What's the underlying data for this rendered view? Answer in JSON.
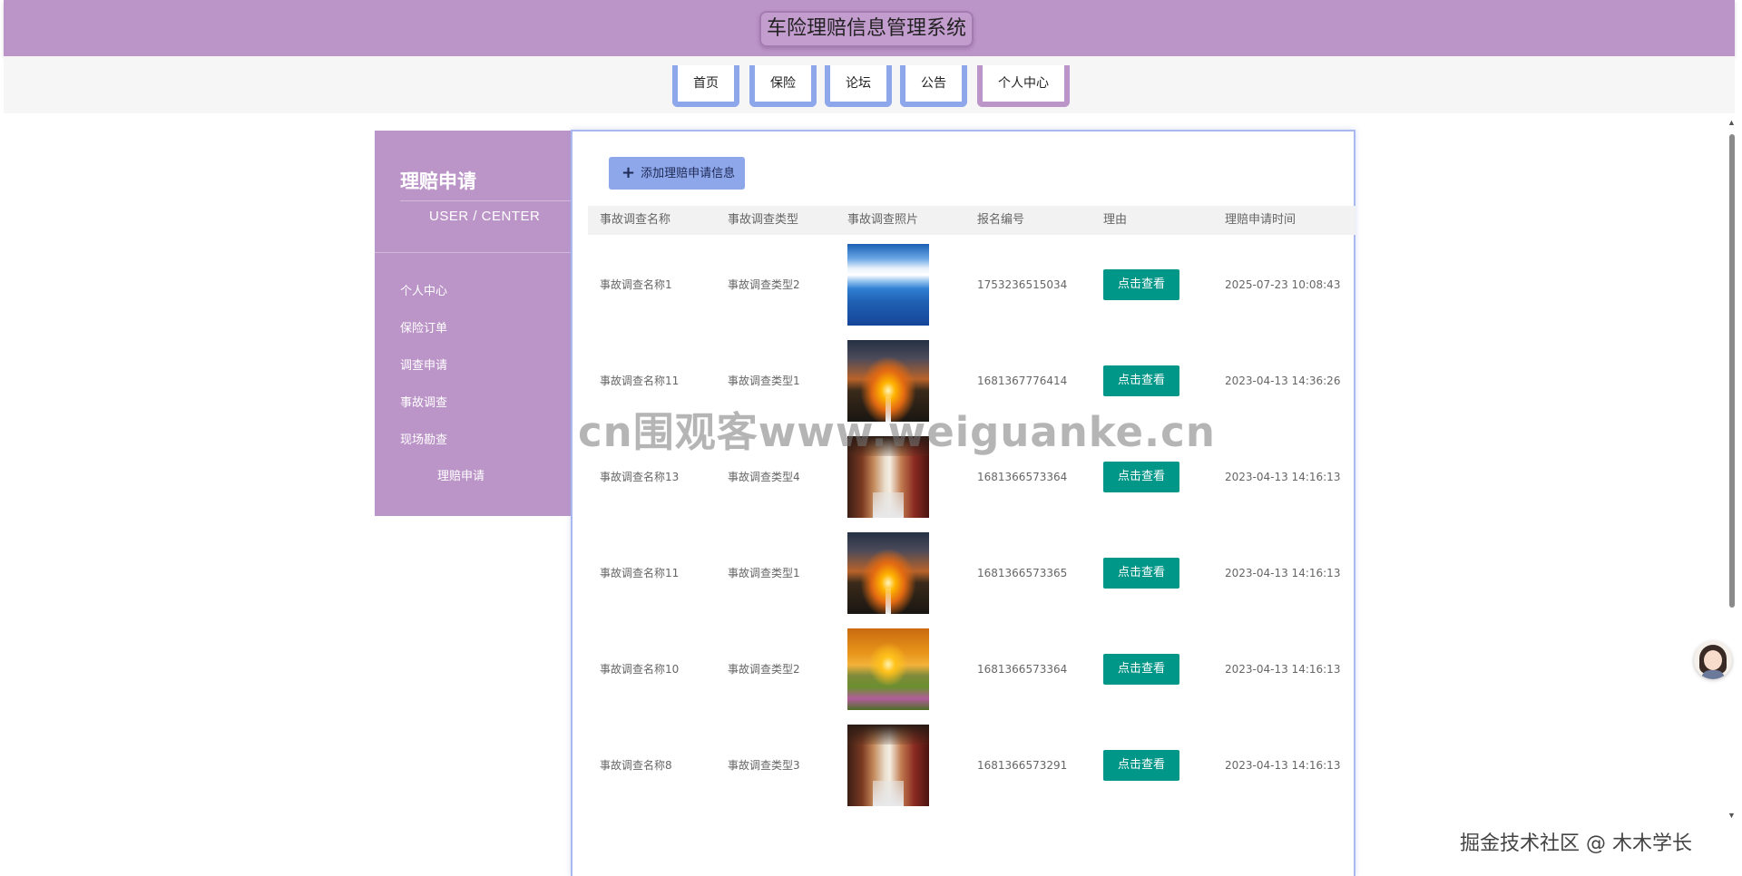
{
  "header": {
    "title": "车险理赔信息管理系统"
  },
  "nav": {
    "items": [
      {
        "label": "首页"
      },
      {
        "label": "保险"
      },
      {
        "label": "论坛"
      },
      {
        "label": "公告"
      },
      {
        "label": "个人中心"
      }
    ],
    "active": "个人中心"
  },
  "sidebar": {
    "title": "理赔申请",
    "subtitle": "USER / CENTER",
    "items": [
      {
        "label": "个人中心"
      },
      {
        "label": "保险订单"
      },
      {
        "label": "调查申请"
      },
      {
        "label": "事故调查"
      },
      {
        "label": "现场勘查"
      },
      {
        "label": "理赔申请"
      }
    ],
    "active": "理赔申请"
  },
  "toolbar": {
    "add_label": "添加理赔申请信息",
    "add_icon": "plus-icon"
  },
  "table": {
    "columns": [
      "事故调查名称",
      "事故调查类型",
      "事故调查照片",
      "报名编号",
      "理由",
      "理赔申请时间"
    ],
    "rows": [
      {
        "name": "事故调查名称1",
        "type": "事故调查类型2",
        "photo": "sea-sky",
        "number": "1753236515034",
        "action": "点击查看",
        "time": "2025-07-23 10:08:43"
      },
      {
        "name": "事故调查名称11",
        "type": "事故调查类型1",
        "photo": "sunset-road",
        "number": "1681367776414",
        "action": "点击查看",
        "time": "2023-04-13 14:36:26"
      },
      {
        "name": "事故调查名称13",
        "type": "事故调查类型4",
        "photo": "corridor",
        "number": "1681366573364",
        "action": "点击查看",
        "time": "2023-04-13 14:16:13"
      },
      {
        "name": "事故调查名称11",
        "type": "事故调查类型1",
        "photo": "sunset-road",
        "number": "1681366573365",
        "action": "点击查看",
        "time": "2023-04-13 14:16:13"
      },
      {
        "name": "事故调查名称10",
        "type": "事故调查类型2",
        "photo": "flower-field",
        "number": "1681366573364",
        "action": "点击查看",
        "time": "2023-04-13 14:16:13"
      },
      {
        "name": "事故调查名称8",
        "type": "事故调查类型3",
        "photo": "corridor",
        "number": "1681366573291",
        "action": "点击查看",
        "time": "2023-04-13 14:16:13"
      }
    ]
  },
  "overlays": {
    "watermark": "cn围观客www.weiguanke.cn",
    "footer_mark": "掘金技术社区 @ 木木学长"
  },
  "colors": {
    "brand": "#bc95c8",
    "accent": "#8ea6ea",
    "action": "#009688"
  }
}
